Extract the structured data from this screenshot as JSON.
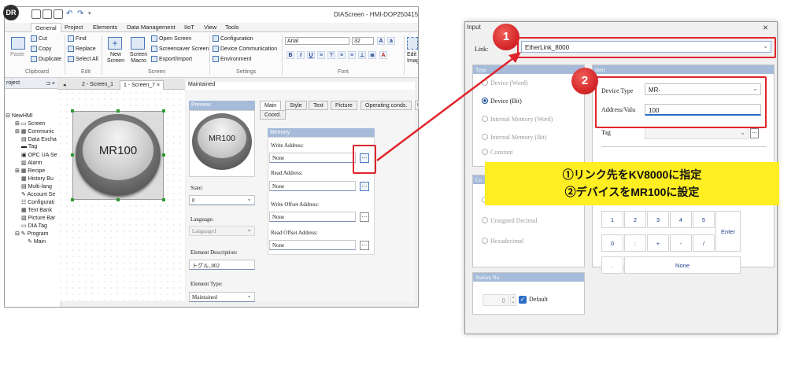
{
  "app": {
    "window_title": "DIAScreen - HMI-DOP250415 - [1",
    "menu": [
      "General",
      "Project",
      "Elements",
      "Data Management",
      "IIoT",
      "View",
      "Tools"
    ],
    "ribbon": {
      "clipboard": {
        "paste": "Paste",
        "cut": "Cut",
        "copy": "Copy",
        "duplicate": "Duplicate",
        "group": "Clipboard"
      },
      "edit": {
        "find": "Find",
        "replace": "Replace",
        "select_all": "Select All",
        "group": "Edit"
      },
      "screen": {
        "new_screen": "New Screen",
        "screen_macro": "Screen Macro",
        "open_screen": "Open Screen",
        "screensaver_screen": "Screensaver Screen",
        "export_import": "Export/Import",
        "group": "Screen"
      },
      "settings": {
        "configuration": "Configuration",
        "device_communication": "Device Communication",
        "environment": "Environment",
        "group": "Settings"
      },
      "font": {
        "family": "Arial",
        "size": "32",
        "bold": "B",
        "italic": "I",
        "underline": "U",
        "group": "Font"
      },
      "edit_image": "Edit Image"
    },
    "project_panel": {
      "title": "roject",
      "pin": "⊐ ×",
      "items": [
        "NewHMI",
        "Screen",
        "Communic",
        "Data Excha",
        "Tag",
        "OPC UA Se",
        "Alarm",
        "Recipe",
        "History Bu",
        "Multi-lang",
        "Account Se",
        "Configurati",
        "Text Bank",
        "Picture Bar",
        "DIA Tag",
        "Program",
        "Main"
      ]
    },
    "doc_tabs": [
      "2 - Screen_1",
      "1 - Screen_7"
    ],
    "doc_tab_close": "×",
    "canvas_button_text": "MR100",
    "properties": {
      "header": "Maintained",
      "preview_label": "Preview",
      "preview_text": "MR100",
      "state_label": "State:",
      "state_value": "0",
      "language_label": "Language:",
      "language_value": "Language1",
      "desc_label": "Element Description:",
      "desc_value": "トグル_002",
      "type_label": "Element Type:",
      "type_value": "Maintained",
      "tabs": [
        "Main",
        "Style",
        "Text",
        "Picture",
        "Operating conds.",
        "Use",
        "Coord."
      ],
      "memory_label": "Memory",
      "write_address_label": "Write Address:",
      "write_address_value": "None",
      "read_address_label": "Read Address:",
      "read_address_value": "None",
      "write_offset_label": "Write Offset Address:",
      "write_offset_value": "None",
      "read_offset_label": "Read Offset Address:",
      "read_offset_value": "None",
      "dots": "..."
    }
  },
  "dialog": {
    "title": "Input",
    "close": "×",
    "link_label": "Link:",
    "link_value": "EtherLink_8000",
    "type_header": "Type",
    "type_options": [
      "Device (Word)",
      "Device (Bit)",
      "Internal Memory (Word)",
      "Internal Memory (Bit)",
      "Constant"
    ],
    "type_selected": "Device (Bit)",
    "device_header": "itent",
    "device_type_label": "Device Type",
    "device_type_value": "MR-",
    "address_label": "Address/Valu",
    "address_value": "100",
    "tag_label": "Tag",
    "co_header": "Co",
    "format_options": [
      "Unsigned Decimal",
      "Hexadecimal"
    ],
    "keypad": [
      "1",
      "2",
      "3",
      "4",
      "5",
      "0",
      ":",
      "+",
      "-",
      "/",
      "."
    ],
    "enter": "Enter",
    "none": "None",
    "station_header": "Station No.",
    "station_value": "0",
    "default_label": "Default"
  },
  "annotations": {
    "badge1": "1",
    "badge2": "2",
    "callout_line1": "①リンク先をKV8000に指定",
    "callout_line2": "②デバイスをMR100に設定",
    "highlight_color": "#e0242b",
    "callout_color": "#ffee22"
  }
}
